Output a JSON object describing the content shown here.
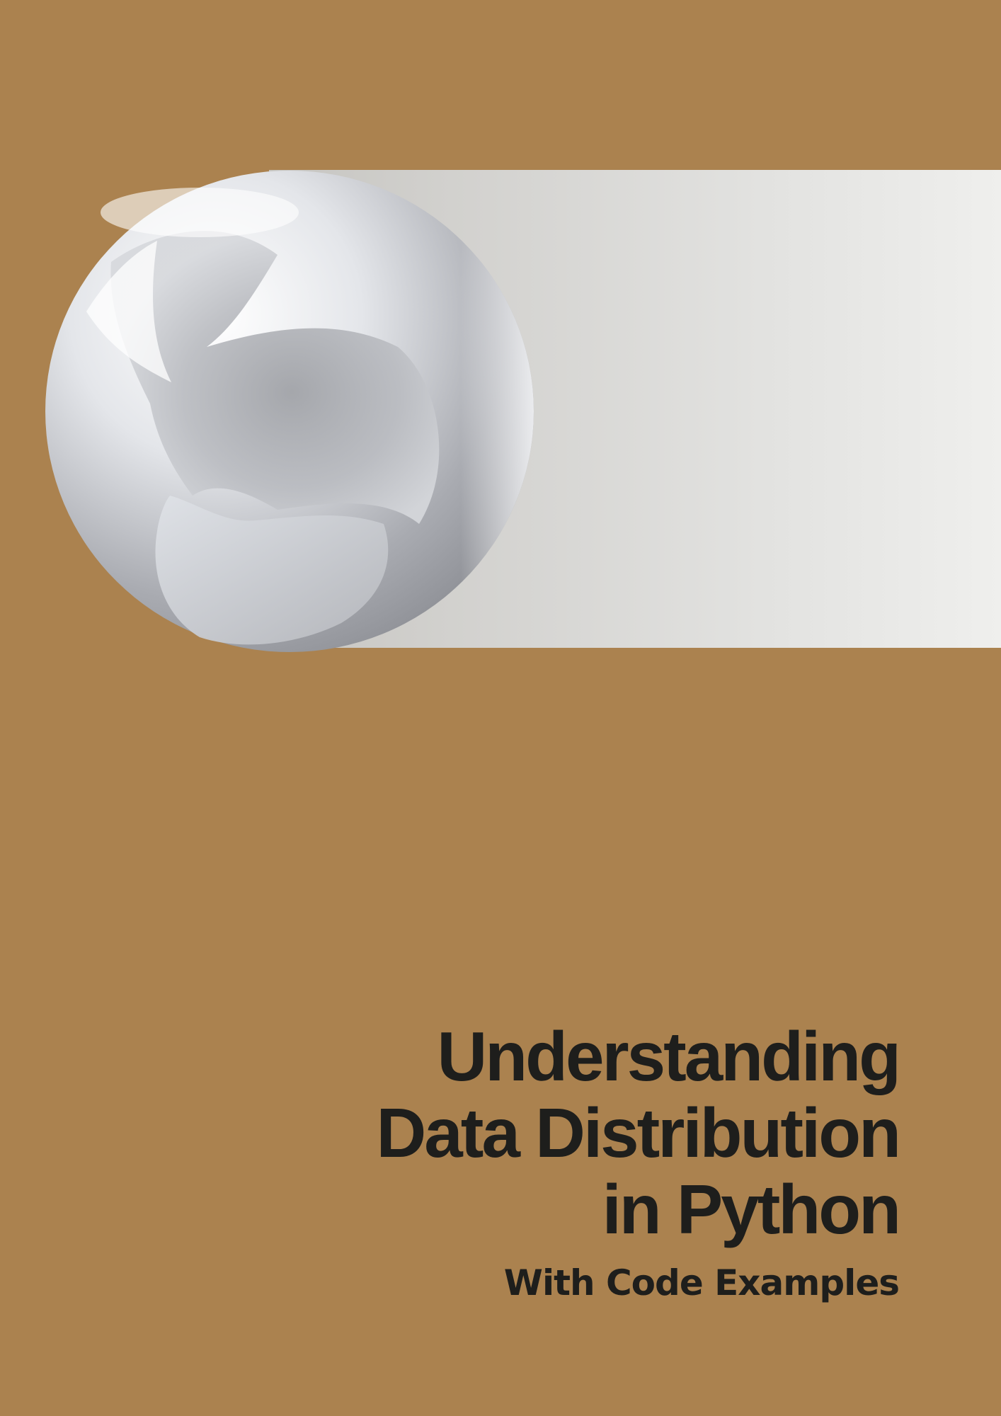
{
  "cover": {
    "title_lines": [
      "Understanding",
      "Data Distribution",
      "in Python"
    ],
    "subtitle": "With Code Examples"
  },
  "colors": {
    "background": "#ab824f",
    "band_start": "#c6c5c1",
    "band_end": "#efefed",
    "text": "#1e1e1c"
  },
  "illustration": {
    "orb_icon": "glossy-sphere-icon"
  }
}
